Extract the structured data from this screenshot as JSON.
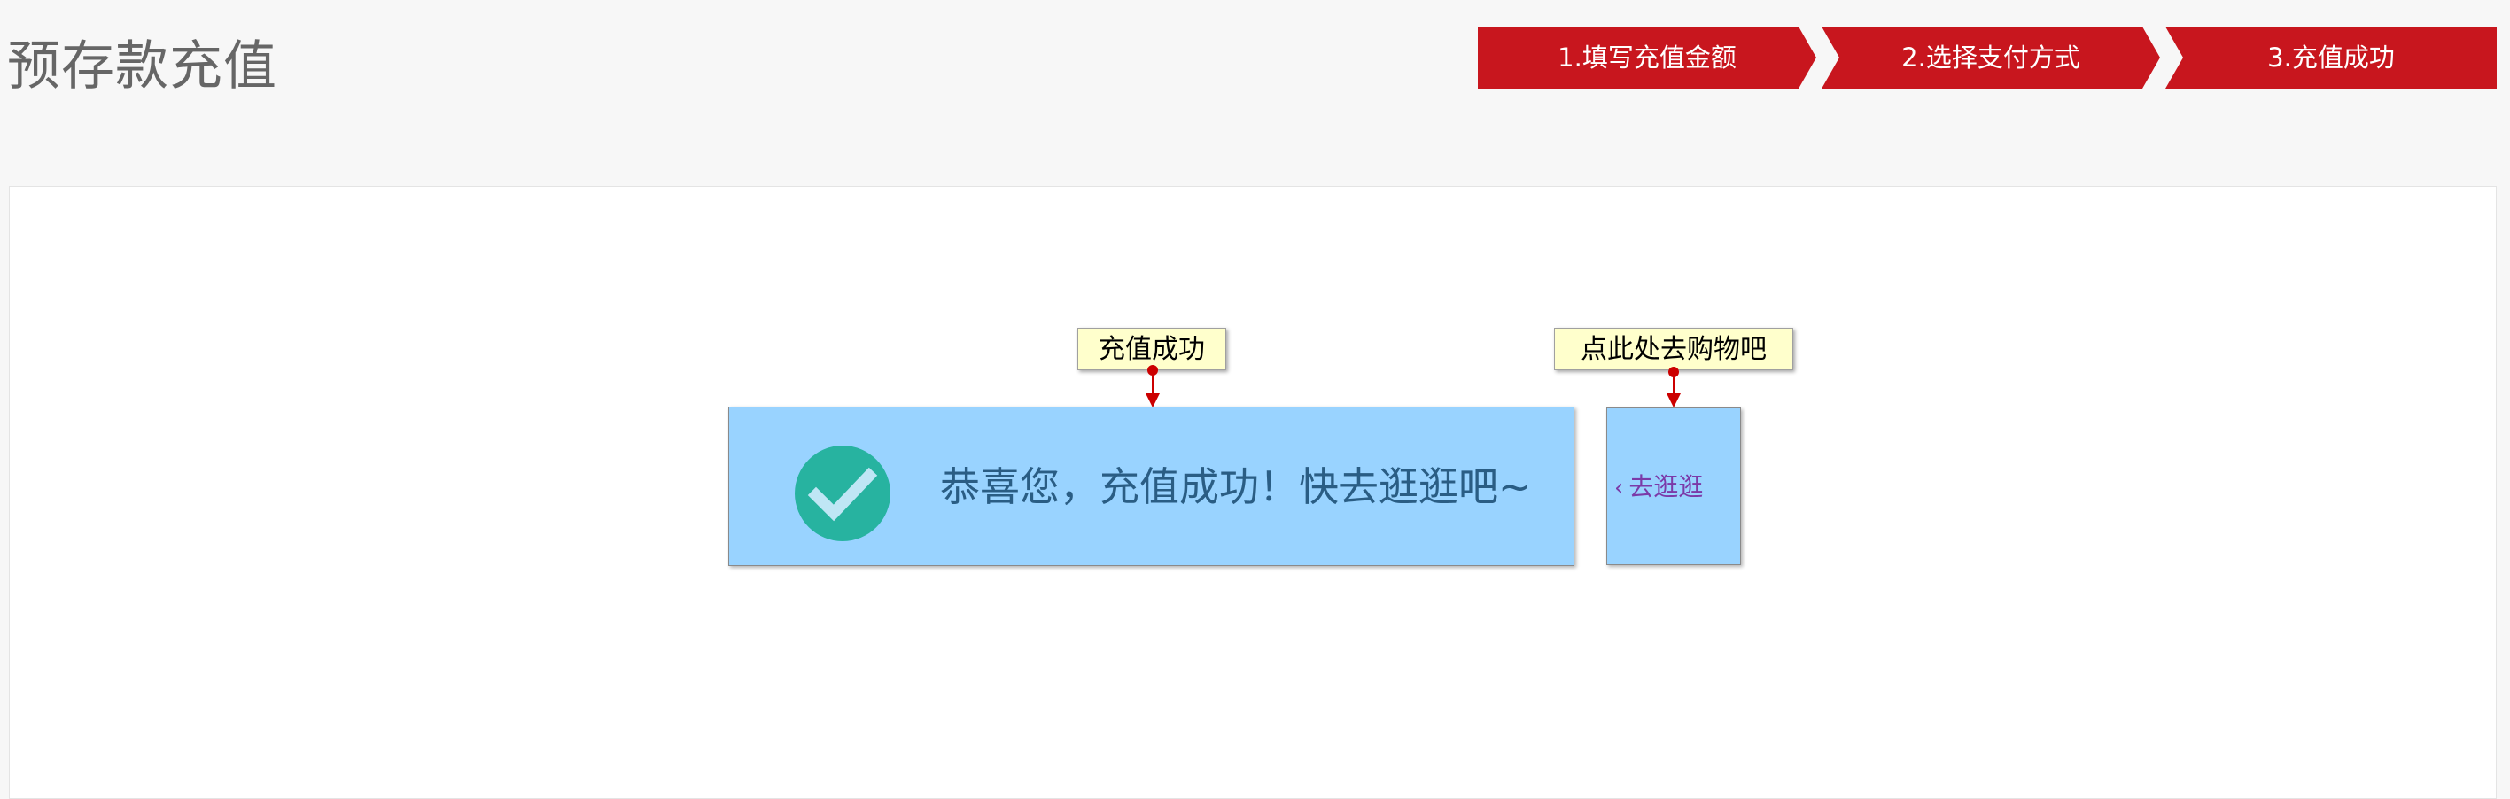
{
  "page": {
    "title": "预存款充值"
  },
  "steps": [
    {
      "label": "1.填写充值金额"
    },
    {
      "label": "2.选择支付方式"
    },
    {
      "label": "3.充值成功"
    }
  ],
  "annotations": {
    "success_label": "充值成功",
    "shop_label": "点此处去购物吧"
  },
  "result": {
    "message": "恭喜您，充值成功！快去逛逛吧~",
    "icon": "check-circle-icon"
  },
  "actions": {
    "shop_link_label": "去逛逛",
    "shop_link_icon": "chevron-left-icon"
  },
  "colors": {
    "accent": "#c8161e",
    "highlight": "#99d3ff",
    "check": "#27b3a0",
    "note": "#ffffcc"
  }
}
